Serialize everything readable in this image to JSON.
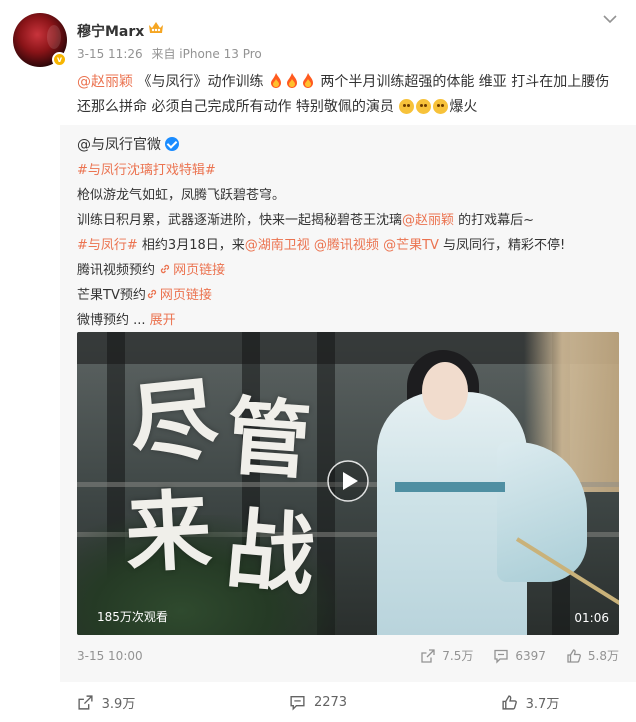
{
  "author": {
    "name": "穆宁Marx",
    "avatar_badge": "v",
    "time": "3-15 11:26",
    "source": "来自 iPhone 13 Pro"
  },
  "post": {
    "mention": "@赵丽颖",
    "text1": " 《与凤行》动作训练 ",
    "text2": " 两个半月训练超强的体能  维亚  打斗在加上腰伤 还那么拼命 必须自己完成所有动作  特别敬佩的演员 ",
    "text3": "爆火"
  },
  "repost": {
    "author": "@与凤行官微",
    "hashtag": "#与凤行沈璃打戏特辑#",
    "line1": "枪似游龙气如虹，凤腾飞跃碧苍穹。",
    "line2_a": "训练日积月累，武器逐渐进阶，快来一起揭秘碧苍王沈璃",
    "line2_mention": "@赵丽颖",
    "line2_b": " 的打戏幕后~",
    "line3_tag": "#与凤行#",
    "line3_a": " 相约3月18日，来",
    "line3_m1": "@湖南卫视",
    "line3_m2": "@腾讯视频",
    "line3_m3": "@芒果TV",
    "line3_b": " 与凤同行，精彩不停!",
    "line4_a": "腾讯视频预约 ",
    "line4_link": "网页链接",
    "line5_a": "芒果TV预约",
    "line5_link": "网页链接",
    "line6_a": "微博预约   ...",
    "expand": "展开",
    "video": {
      "title_chars": [
        "尽",
        "管",
        "来",
        "战"
      ],
      "views": "185万次观看",
      "duration": "01:06"
    },
    "time": "3-15 10:00",
    "actions": {
      "share": "7.5万",
      "comment": "6397",
      "like": "5.8万"
    }
  },
  "footer": {
    "share": "3.9万",
    "comment": "2273",
    "like": "3.7万"
  },
  "colors": {
    "accent": "#eb7350",
    "verified": "#1a8cff",
    "meta": "#939393"
  }
}
